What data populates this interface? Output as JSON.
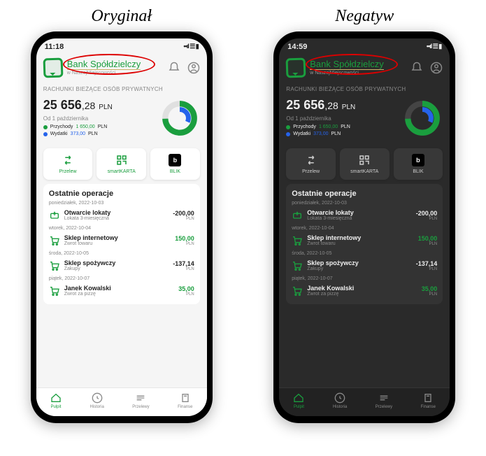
{
  "titles": {
    "original": "Oryginał",
    "negative": "Negatyw"
  },
  "status": {
    "time_light": "11:18",
    "time_dark": "14:59"
  },
  "bank": {
    "name": "Bank Spółdzielczy",
    "subtitle": "w NaszejMiejscowości"
  },
  "account": {
    "section_label": "RACHUNKI BIEŻĄCE OSÓB PRYWATNYCH",
    "balance_int": "25 656",
    "balance_dec": ",28",
    "currency": "PLN",
    "since": "Od 1 października",
    "legend": [
      {
        "label": "Przychody",
        "value": "1 650,00",
        "unit": "PLN",
        "cls": "g"
      },
      {
        "label": "Wydatki",
        "value": "373,00",
        "unit": "PLN",
        "cls": "b"
      }
    ]
  },
  "actions": [
    {
      "label": "Przelew",
      "icon": "transfer"
    },
    {
      "label": "smartKARTA",
      "icon": "qr"
    },
    {
      "label": "BLIK",
      "icon": "blik"
    }
  ],
  "ops": {
    "title": "Ostatnie operacje",
    "groups": [
      {
        "date": "poniedziałek, 2022-10-03",
        "items": [
          {
            "icon": "deposit",
            "name": "Otwarcie lokaty",
            "desc": "Lokata 3-miesięczna",
            "amount": "-200,00",
            "cur": "PLN",
            "sign": "neg"
          }
        ]
      },
      {
        "date": "wtorek, 2022-10-04",
        "items": [
          {
            "icon": "cart",
            "name": "Sklep internetowy",
            "desc": "Zwrot towaru",
            "amount": "150,00",
            "cur": "PLN",
            "sign": "pos"
          }
        ]
      },
      {
        "date": "środa, 2022-10-05",
        "items": [
          {
            "icon": "cart",
            "name": "Sklep spożywczy",
            "desc": "Zakupy",
            "amount": "-137,14",
            "cur": "PLN",
            "sign": "neg"
          }
        ]
      },
      {
        "date": "piątek, 2022-10-07",
        "items": [
          {
            "icon": "cart",
            "name": "Janek Kowalski",
            "desc": "Zwrot za pizzę",
            "amount": "35,00",
            "cur": "PLN",
            "sign": "pos"
          }
        ]
      }
    ]
  },
  "tabs": [
    {
      "label": "Pulpit",
      "active": true
    },
    {
      "label": "Historia",
      "active": false
    },
    {
      "label": "Przelewy",
      "active": false
    },
    {
      "label": "Finanse",
      "active": false
    }
  ]
}
